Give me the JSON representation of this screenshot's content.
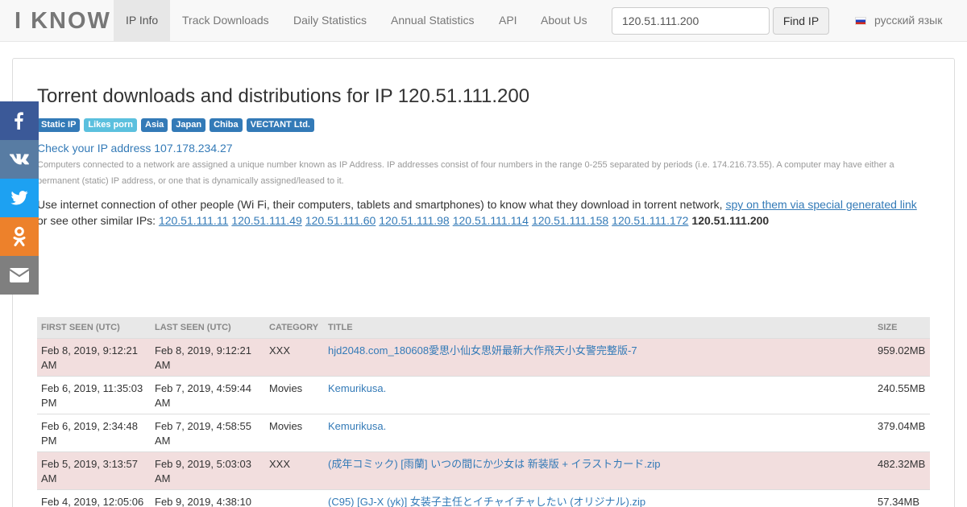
{
  "navbar": {
    "brand": "I KNOW",
    "items": [
      {
        "label": "IP Info"
      },
      {
        "label": "Track Downloads"
      },
      {
        "label": "Daily Statistics"
      },
      {
        "label": "Annual Statistics"
      },
      {
        "label": "API"
      },
      {
        "label": "About Us"
      }
    ],
    "search_value": "120.51.111.200",
    "find_button": "Find IP",
    "language": "русский язык"
  },
  "page": {
    "title": "Torrent downloads and distributions for IP 120.51.111.200",
    "badges": [
      "Static IP",
      "Likes porn",
      "Asia",
      "Japan",
      "Chiba",
      "VECTANT Ltd."
    ],
    "check_ip": "Check your IP address 107.178.234.27",
    "description": "Computers connected to a network are assigned a unique number known as IP Address. IP addresses consist of four numbers in the range 0-255 separated by periods (i.e. 174.216.73.55). A computer may have either a permanent (static) IP address, or one that is dynamically assigned/leased to it.",
    "spy_text": "Use internet connection of other people (Wi Fi, their computers, tablets and smartphones) to know what they download in torrent network, ",
    "spy_link": "spy on them via special generated link",
    "similar_label": "or see other similar IPs: ",
    "similar_ips": [
      "120.51.111.11",
      "120.51.111.49",
      "120.51.111.60",
      "120.51.111.98",
      "120.51.111.114",
      "120.51.111.158",
      "120.51.111.172"
    ],
    "current_ip": "120.51.111.200"
  },
  "social": [
    {
      "icon": "facebook-icon",
      "color": "#3b5998"
    },
    {
      "icon": "vk-icon",
      "color": "#587ca3"
    },
    {
      "icon": "twitter-icon",
      "color": "#1da1f2"
    },
    {
      "icon": "odnoklassniki-icon",
      "color": "#ed812b"
    },
    {
      "icon": "email-icon",
      "color": "#7f7f7f"
    }
  ],
  "table": {
    "headers": [
      "FIRST SEEN (UTC)",
      "LAST SEEN (UTC)",
      "CATEGORY",
      "TITLE",
      "SIZE"
    ],
    "rows": [
      {
        "first": "Feb 8, 2019, 9:12:21 AM",
        "last": "Feb 8, 2019, 9:12:21 AM",
        "category": "XXX",
        "title": "hjd2048.com_180608愛思小仙女思妍最新大作飛天小女警完整版-7",
        "size": "959.02MB"
      },
      {
        "first": "Feb 6, 2019, 11:35:03 PM",
        "last": "Feb 7, 2019, 4:59:44 AM",
        "category": "Movies",
        "title": "Kemurikusa.",
        "size": "240.55MB"
      },
      {
        "first": "Feb 6, 2019, 2:34:48 PM",
        "last": "Feb 7, 2019, 4:58:55 AM",
        "category": "Movies",
        "title": "Kemurikusa.",
        "size": "379.04MB"
      },
      {
        "first": "Feb 5, 2019, 3:13:57 AM",
        "last": "Feb 9, 2019, 5:03:03 AM",
        "category": "XXX",
        "title": "(成年コミック) [雨蘭] いつの間にか少女は 新装版 + イラストカード.zip",
        "size": "482.32MB"
      },
      {
        "first": "Feb 4, 2019, 12:05:06",
        "last": "Feb 9, 2019, 4:38:10",
        "category": "",
        "title": "(C95) [GJ-X (yk)] 女装子主任とイチャイチャしたい (オリジナル).zip",
        "size": "57.34MB"
      }
    ]
  }
}
